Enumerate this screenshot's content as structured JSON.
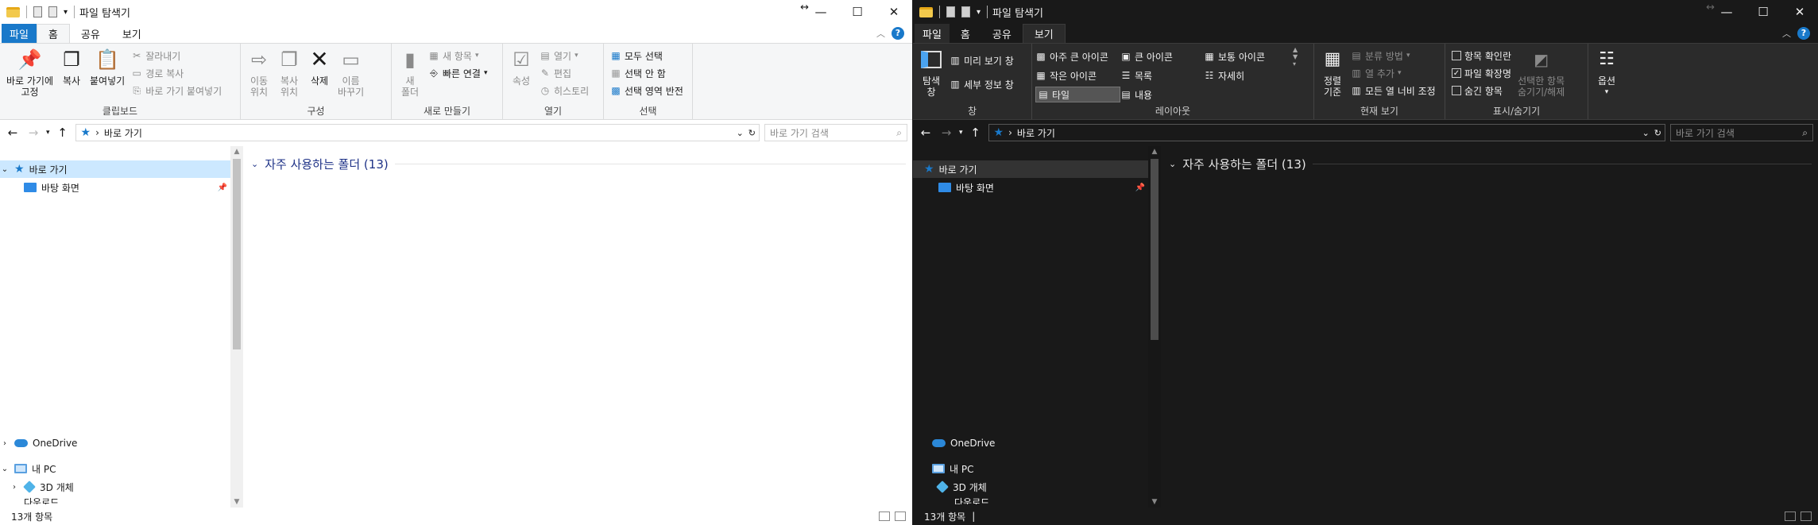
{
  "left": {
    "title": "파일 탐색기",
    "tabs": {
      "file": "파일",
      "home": "홈",
      "share": "공유",
      "view": "보기"
    },
    "ribbon": {
      "clipboard": {
        "label": "클립보드",
        "pin_l1": "바로 가기에",
        "pin_l2": "고정",
        "copy": "복사",
        "paste": "붙여넣기",
        "cut": "잘라내기",
        "copy_path": "경로 복사",
        "paste_shortcut": "바로 가기 붙여넣기"
      },
      "organize": {
        "label": "구성",
        "move_l1": "이동",
        "move_l2": "위치",
        "copyto_l1": "복사",
        "copyto_l2": "위치",
        "delete": "삭제",
        "rename_l1": "이름",
        "rename_l2": "바꾸기"
      },
      "new": {
        "label": "새로 만들기",
        "folder_l1": "새",
        "folder_l2": "폴더",
        "new_item": "새 항목",
        "easy_access": "빠른 연결"
      },
      "open": {
        "label": "열기",
        "properties": "속성",
        "open": "열기",
        "edit": "편집",
        "history": "히스토리"
      },
      "select": {
        "label": "선택",
        "select_all": "모두 선택",
        "select_none": "선택 안 함",
        "invert": "선택 영역 반전"
      }
    },
    "address": {
      "path": "바로 가기",
      "search_placeholder": "바로 가기 검색"
    },
    "nav": {
      "quick_access": "바로 가기",
      "desktop": "바탕 화면",
      "onedrive": "OneDrive",
      "this_pc": "내 PC",
      "objects3d": "3D 개체",
      "downloads": "다운로드"
    },
    "content": {
      "section": "자주 사용하는 폴더 (13)"
    },
    "status": {
      "count": "13개 항목"
    }
  },
  "right": {
    "title": "파일 탐색기",
    "tabs": {
      "file": "파일",
      "home": "홈",
      "share": "공유",
      "view": "보기"
    },
    "ribbon": {
      "panes": {
        "label": "창",
        "nav_pane_l1": "탐색",
        "nav_pane_l2": "창",
        "preview": "미리 보기 창",
        "details": "세부 정보 창"
      },
      "layout": {
        "label": "레이아웃",
        "extra_large": "아주 큰 아이콘",
        "large": "큰 아이콘",
        "medium": "보통 아이콘",
        "small": "작은 아이콘",
        "list": "목록",
        "details": "자세히",
        "tiles": "타일",
        "content": "내용"
      },
      "current_view": {
        "label": "현재 보기",
        "sort_l1": "정렬",
        "sort_l2": "기준",
        "group_by": "분류 방법",
        "add_columns": "열 추가",
        "fit_columns": "모든 열 너비 조정"
      },
      "show_hide": {
        "label": "표시/숨기기",
        "checkboxes": "항목 확인란",
        "extensions": "파일 확장명",
        "hidden": "숨긴 항목",
        "hide_sel_l1": "선택한 항목",
        "hide_sel_l2": "숨기기/해제"
      },
      "options": {
        "label": "옵션"
      }
    },
    "address": {
      "path": "바로 가기",
      "search_placeholder": "바로 가기 검색"
    },
    "nav": {
      "quick_access": "바로 가기",
      "desktop": "바탕 화면",
      "onedrive": "OneDrive",
      "this_pc": "내 PC",
      "objects3d": "3D 개체",
      "downloads": "다운로드"
    },
    "content": {
      "section": "자주 사용하는 폴더 (13)"
    },
    "status": {
      "count": "13개 항목"
    }
  }
}
